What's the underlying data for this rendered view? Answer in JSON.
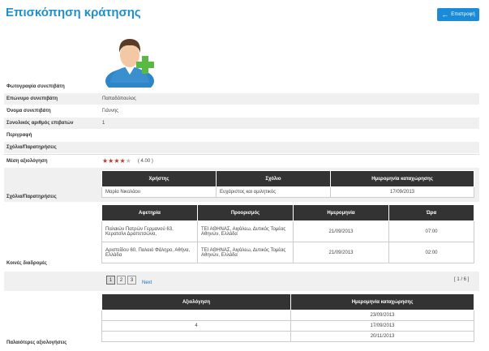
{
  "title": "Επισκόπηση κράτησης",
  "back_button": {
    "label": "Επιστροφή"
  },
  "fields": {
    "photo_label": "Φωτογραφία συνεπιβάτη",
    "surname_label": "Επώνυμο συνεπιβάτη",
    "surname_value": "Παπαδόπουλος",
    "name_label": "Όνομα συνεπιβάτη",
    "name_value": "Γιάννης",
    "total_passengers_label": "Συνολικός αριθμός επιβατών",
    "total_passengers_value": "1",
    "description_label": "Περιγραφή",
    "comments_label": "Σχόλια/Παρατηρήσεις",
    "avg_rating_label": "Μέση αξιολόγηση",
    "avg_rating_value": "( 4.00 )",
    "avg_rating_stars": 4,
    "comments_section_label": "Σχόλια/Παρατηρήσεις",
    "routes_label": "Κοινές διαδρομές",
    "older_ratings_label": "Παλαιότερες αξιολογήσεις"
  },
  "comments_table": {
    "headers": [
      "Χρήστης",
      "Σχόλιο",
      "Ημερομηνία καταχώρησης"
    ],
    "rows": [
      [
        "Μαρία Νικολάου",
        "Ευχάριστος και ομιλητικός",
        "17/09/2013"
      ]
    ]
  },
  "routes_table": {
    "headers": [
      "Αφετηρία",
      "Προορισμός",
      "Ημερομηνία",
      "Ώρα"
    ],
    "rows": [
      [
        "Παλαιών Πατρών Γερμανού 63, Κερατσίνι Δραπετσώνα,",
        "ΤΕΙ ΑΘΗΝΑΣ, Αιγάλεω, Δυτικός Τομέας Αθηνών, Ελλάδα",
        "21/09/2013",
        "07:00"
      ],
      [
        "Αριστείδου 60, Παλαιό Φάληρο, Αθήνα, Ελλάδα",
        "ΤΕΙ ΑΘΗΝΑΣ, Αιγάλεω, Δυτικός Τομέας Αθηνών, Ελλάδα",
        "21/09/2013",
        "02:00"
      ]
    ]
  },
  "pager": {
    "pages": [
      "1",
      "2",
      "3"
    ],
    "next": "Next",
    "count": "[ 1 / 6 ]"
  },
  "ratings_table": {
    "headers": [
      "Αξιολόγηση",
      "Ημερομηνία καταχώρησης"
    ],
    "rows": [
      [
        "",
        "23/09/2013"
      ],
      [
        "4",
        "17/09/2013"
      ],
      [
        "",
        "20/11/2013"
      ]
    ]
  }
}
